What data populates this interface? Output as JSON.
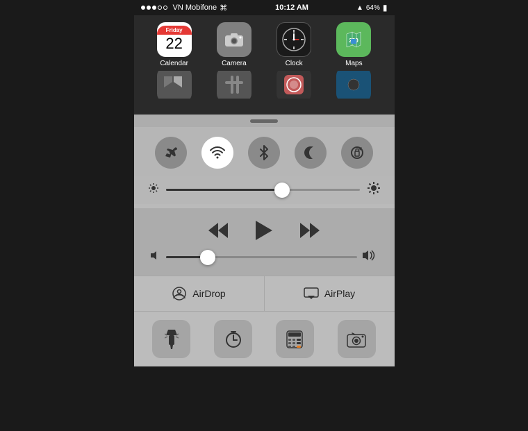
{
  "statusBar": {
    "carrier": "VN Mobifone",
    "time": "10:12 AM",
    "battery": "64%"
  },
  "apps": [
    {
      "name": "Calendar",
      "icon": "calendar",
      "label": "Calendar"
    },
    {
      "name": "Camera",
      "icon": "camera",
      "label": "Camera"
    },
    {
      "name": "Clock",
      "icon": "clock",
      "label": "Clock"
    },
    {
      "name": "Maps",
      "icon": "maps",
      "label": "Maps"
    }
  ],
  "toggles": [
    {
      "id": "airplane",
      "label": "Airplane Mode",
      "active": false
    },
    {
      "id": "wifi",
      "label": "Wi-Fi",
      "active": true
    },
    {
      "id": "bluetooth",
      "label": "Bluetooth",
      "active": false
    },
    {
      "id": "donotdisturb",
      "label": "Do Not Disturb",
      "active": false
    },
    {
      "id": "rotation",
      "label": "Rotation Lock",
      "active": false
    }
  ],
  "brightness": {
    "value": 60,
    "label": "Brightness"
  },
  "volume": {
    "value": 22,
    "label": "Volume"
  },
  "mediaControls": {
    "rewind": "⏮",
    "play": "▶",
    "fastforward": "⏭"
  },
  "airdrop": {
    "label": "AirDrop"
  },
  "airplay": {
    "label": "AirPlay"
  },
  "tools": [
    {
      "id": "flashlight",
      "label": "Flashlight"
    },
    {
      "id": "timer",
      "label": "Timer"
    },
    {
      "id": "calculator",
      "label": "Calculator"
    },
    {
      "id": "camera",
      "label": "Camera"
    }
  ],
  "calDate": {
    "day": "Friday",
    "num": "22"
  }
}
